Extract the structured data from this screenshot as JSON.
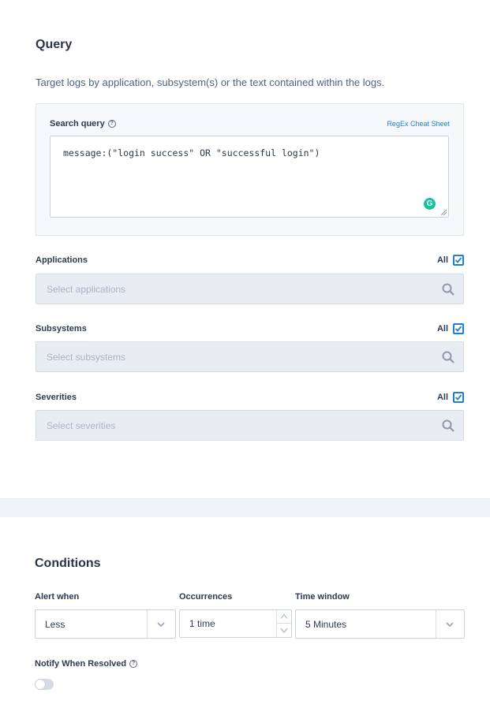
{
  "query": {
    "title": "Query",
    "description": "Target logs by application, subsystem(s) or the text contained within the logs.",
    "search_query_label": "Search query",
    "regex_link": "RegEx Cheat Sheet",
    "search_query_value": "message:(\"login success\" OR \"successful login\")",
    "grammarly_glyph": "G",
    "filters": [
      {
        "label": "Applications",
        "all_label": "All",
        "all_checked": true,
        "placeholder": "Select applications"
      },
      {
        "label": "Subsystems",
        "all_label": "All",
        "all_checked": true,
        "placeholder": "Select subsystems"
      },
      {
        "label": "Severities",
        "all_label": "All",
        "all_checked": true,
        "placeholder": "Select severities"
      }
    ]
  },
  "conditions": {
    "title": "Conditions",
    "alert_when": {
      "label": "Alert when",
      "value": "Less"
    },
    "occurrences": {
      "label": "Occurrences",
      "value": "1 time"
    },
    "time_window": {
      "label": "Time window",
      "value": "5 Minutes"
    },
    "notify_when_resolved": {
      "label": "Notify When Resolved",
      "enabled": false
    }
  },
  "colors": {
    "accent": "#1f7fd1",
    "grammarly": "#15c39a",
    "band": "#f0f3f8"
  }
}
